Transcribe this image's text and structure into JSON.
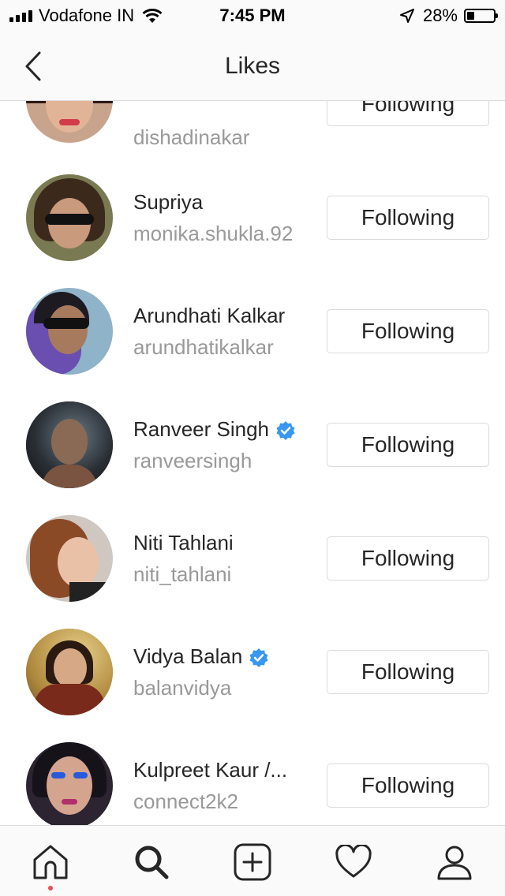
{
  "status_bar": {
    "carrier": "Vodafone IN",
    "time": "7:45 PM",
    "battery_percent": "28%",
    "battery_level": 0.28,
    "icons": [
      "signal-icon",
      "wifi-icon",
      "location-arrow-icon",
      "battery-icon"
    ]
  },
  "header": {
    "title": "Likes",
    "back_icon": "chevron-left-icon"
  },
  "users": [
    {
      "name": "",
      "handle": "dishadinakar",
      "verified": false,
      "button": "Following"
    },
    {
      "name": "Supriya",
      "handle": "monika.shukla.92",
      "verified": false,
      "button": "Following"
    },
    {
      "name": "Arundhati Kalkar",
      "handle": "arundhatikalkar",
      "verified": false,
      "button": "Following"
    },
    {
      "name": "Ranveer Singh",
      "handle": "ranveersingh",
      "verified": true,
      "button": "Following"
    },
    {
      "name": "Niti Tahlani",
      "handle": "niti_tahlani",
      "verified": false,
      "button": "Following"
    },
    {
      "name": "Vidya Balan",
      "handle": "balanvidya",
      "verified": true,
      "button": "Following"
    },
    {
      "name": "Kulpreet Kaur /...",
      "handle": "connect2k2",
      "verified": false,
      "button": "Following"
    }
  ],
  "tab_bar": {
    "items": [
      "home-icon",
      "search-icon",
      "new-post-icon",
      "activity-heart-icon",
      "profile-icon"
    ],
    "active": "home-icon",
    "notification_dot_color": "#ed4956"
  },
  "colors": {
    "verified_badge": "#3897f0",
    "handle_text": "#999999",
    "border": "#dbdbdb"
  }
}
